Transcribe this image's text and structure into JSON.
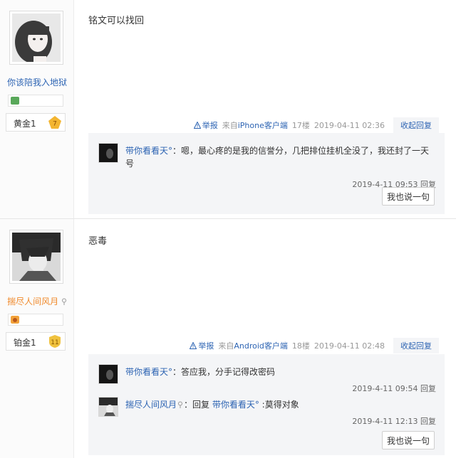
{
  "posts": [
    {
      "username": "你该陪我入地狱",
      "level": "黄金1",
      "level_num": "7",
      "content": "铭文可以找回",
      "report": "举报",
      "client_prefix": "来自",
      "client": "iPhone客户端",
      "floor": "17楼",
      "time": "2019-04-11 02:36",
      "fold": "收起回复",
      "replies": [
        {
          "user": "带你看看天°",
          "text_sep": "：",
          "text": "嗯，最心疼的是我的信誉分，几把排位挂机全没了，我还封了一天号",
          "time": "2019-4-11 09:53",
          "reply": "回复"
        }
      ],
      "say": "我也说一句"
    },
    {
      "username": "揣尽人间风月",
      "level": "铂金1",
      "level_num": "11",
      "content": "恶毒",
      "report": "举报",
      "client_prefix": "来自",
      "client": "Android客户端",
      "floor": "18楼",
      "time": "2019-04-11 02:48",
      "fold": "收起回复",
      "replies": [
        {
          "user": "带你看看天°",
          "text_sep": "：",
          "text": "答应我，分手记得改密码",
          "time": "2019-4-11 09:54",
          "reply": "回复"
        },
        {
          "user": "揣尽人间风月",
          "text_sep": "：回复 ",
          "target": "带你看看天°",
          "text": " :莫得对象",
          "time": "2019-4-11 12:13",
          "reply": "回复"
        }
      ],
      "say": "我也说一句"
    }
  ],
  "colors": {
    "link": "#2d64b3",
    "orange_name": "#f08a2c",
    "gold_shield": "#f3b531",
    "platinum_shield": "#f0c23e"
  }
}
